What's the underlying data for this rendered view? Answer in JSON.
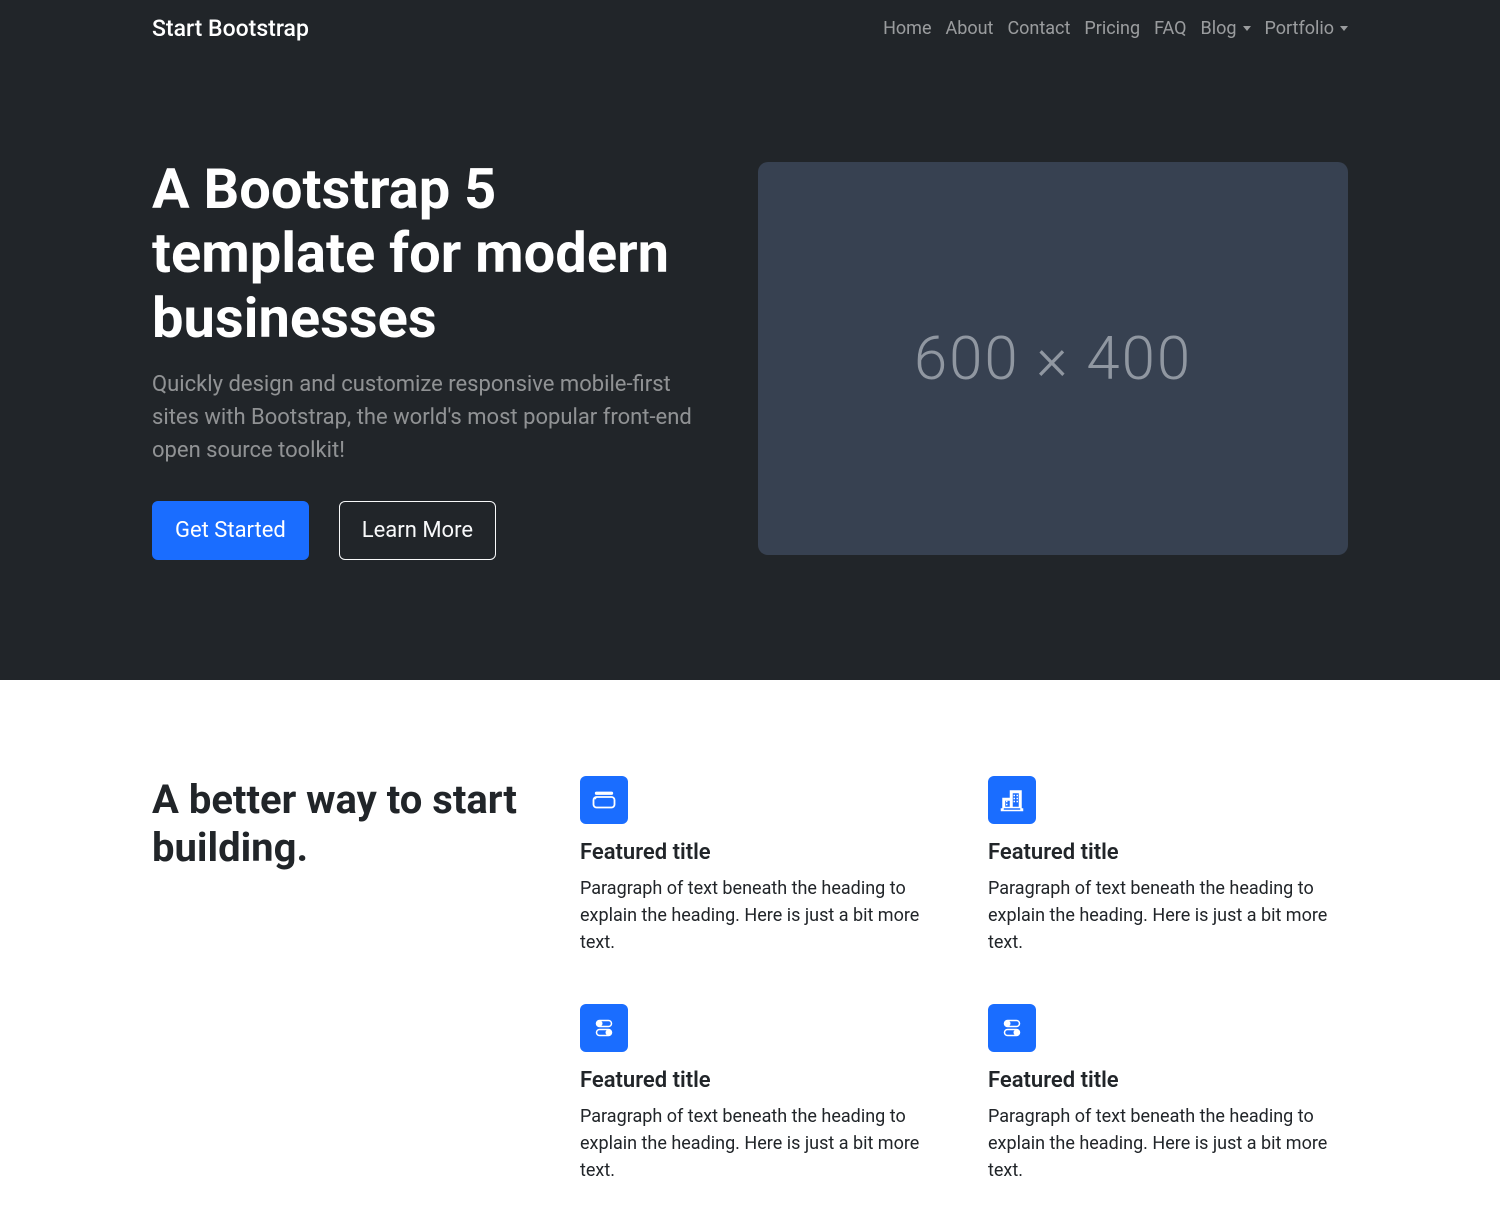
{
  "brand": "Start Bootstrap",
  "nav": {
    "items": [
      {
        "label": "Home",
        "dropdown": false
      },
      {
        "label": "About",
        "dropdown": false
      },
      {
        "label": "Contact",
        "dropdown": false
      },
      {
        "label": "Pricing",
        "dropdown": false
      },
      {
        "label": "FAQ",
        "dropdown": false
      },
      {
        "label": "Blog",
        "dropdown": true
      },
      {
        "label": "Portfolio",
        "dropdown": true
      }
    ]
  },
  "hero": {
    "title": "A Bootstrap 5 template for modern businesses",
    "lead": "Quickly design and customize responsive mobile-first sites with Bootstrap, the world's most popular front-end open source toolkit!",
    "primary_cta": "Get Started",
    "secondary_cta": "Learn More",
    "placeholder_text": "600 × 400"
  },
  "features": {
    "heading": "A better way to start building.",
    "items": [
      {
        "icon": "collection",
        "title": "Featured title",
        "text": "Paragraph of text beneath the heading to explain the heading. Here is just a bit more text."
      },
      {
        "icon": "building",
        "title": "Featured title",
        "text": "Paragraph of text beneath the heading to explain the heading. Here is just a bit more text."
      },
      {
        "icon": "toggles",
        "title": "Featured title",
        "text": "Paragraph of text beneath the heading to explain the heading. Here is just a bit more text."
      },
      {
        "icon": "toggles",
        "title": "Featured title",
        "text": "Paragraph of text beneath the heading to explain the heading. Here is just a bit more text."
      }
    ]
  }
}
